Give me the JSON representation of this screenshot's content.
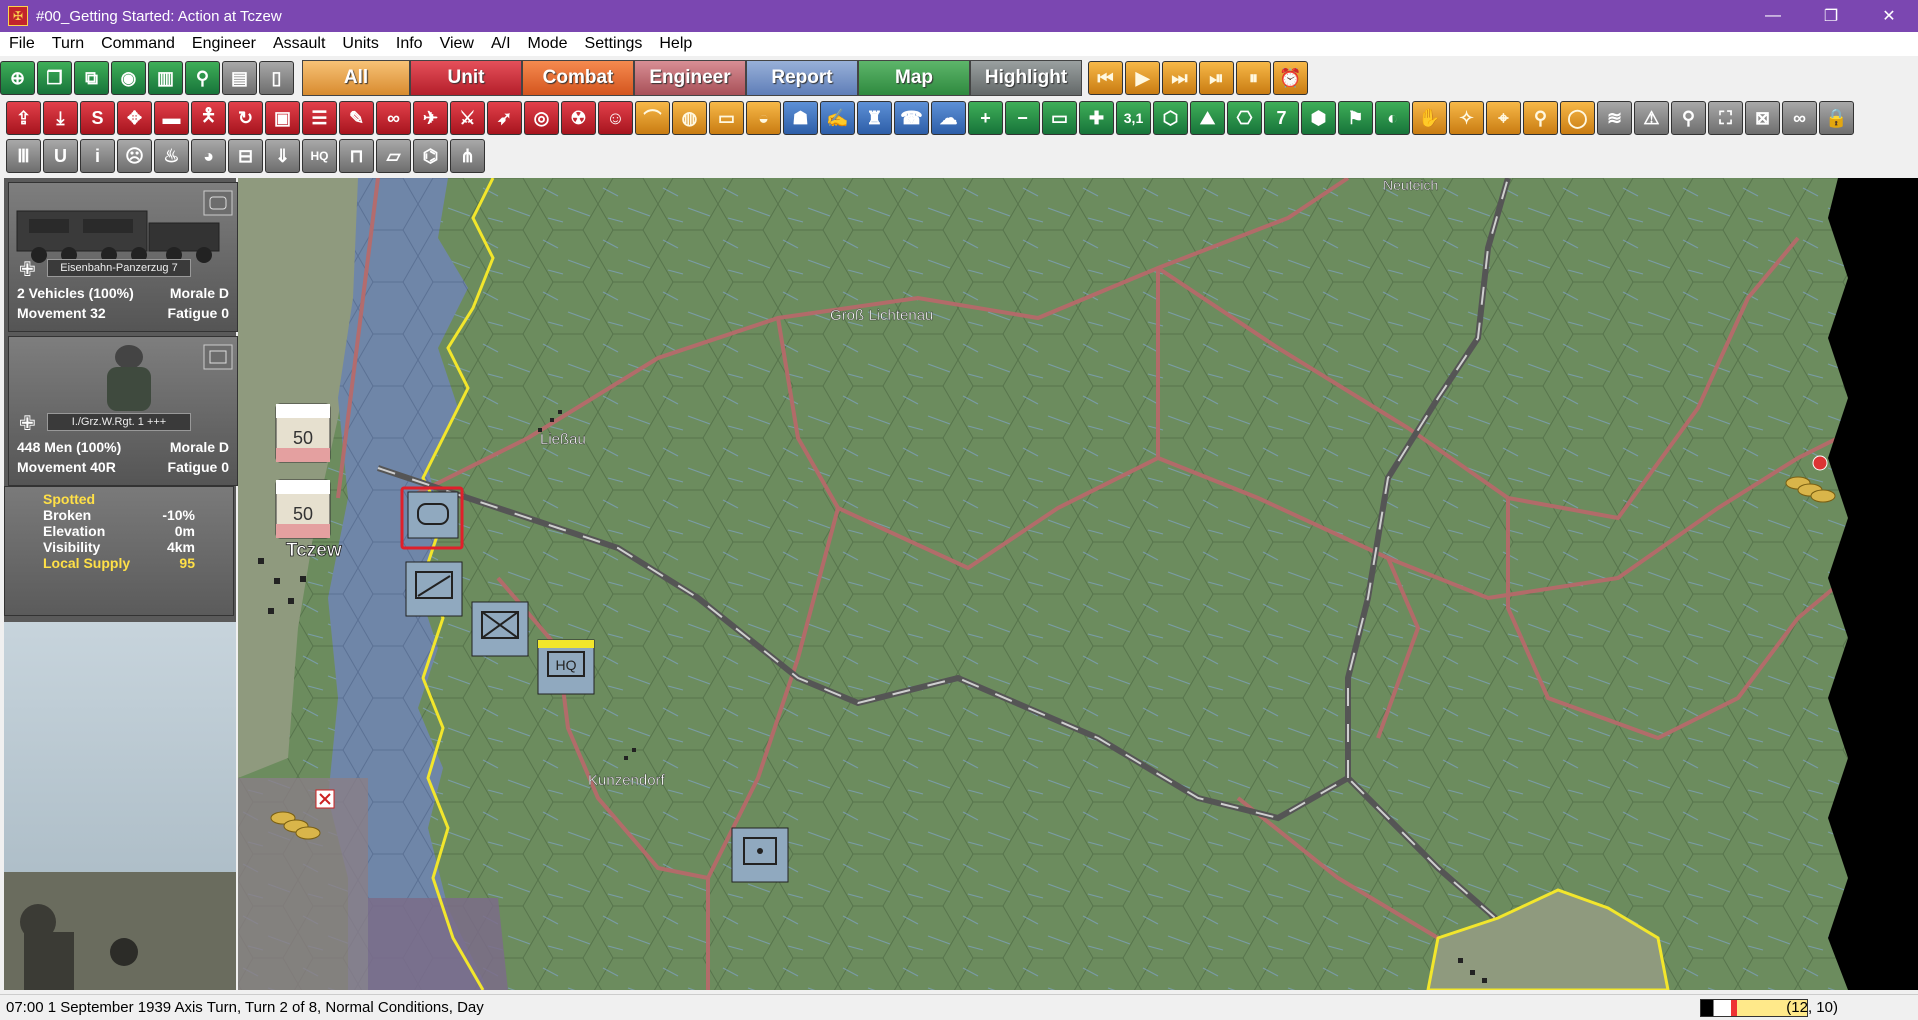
{
  "window": {
    "title": "#00_Getting Started: Action at Tczew",
    "minimize": "—",
    "restore": "❐",
    "close": "✕"
  },
  "menu": [
    "File",
    "Turn",
    "Command",
    "Engineer",
    "Assault",
    "Units",
    "Info",
    "View",
    "A/I",
    "Mode",
    "Settings",
    "Help"
  ],
  "toolbar": {
    "tabs": [
      "All",
      "Unit",
      "Combat",
      "Engineer",
      "Report",
      "Map",
      "Highlight"
    ],
    "row2_text": [
      "S",
      "3,1",
      "7"
    ],
    "row3_text": [
      "U",
      "i",
      "HQ"
    ]
  },
  "units": [
    {
      "name": "Eisenbahn-Panzerzug 7",
      "strength": "2 Vehicles (100%)",
      "morale": "Morale D",
      "movement": "Movement 32",
      "fatigue": "Fatigue 0"
    },
    {
      "name": "I./Grz.W.Rgt. 1 +++",
      "strength": "448 Men (100%)",
      "morale": "Morale D",
      "movement": "Movement 40R",
      "fatigue": "Fatigue 0"
    }
  ],
  "terrain": {
    "spotted": "Spotted",
    "rows": [
      {
        "label": "Broken",
        "value": "-10%"
      },
      {
        "label": "Elevation",
        "value": "0m"
      },
      {
        "label": "Visibility",
        "value": "4km"
      },
      {
        "label": "Local Supply",
        "value": "95"
      }
    ]
  },
  "map": {
    "places": [
      "Neuteich",
      "Groß Lichtenau",
      "Ließau",
      "Tczew",
      "Kunzendorf"
    ],
    "counters": [
      {
        "kind": "polish",
        "value": "50"
      },
      {
        "kind": "polish",
        "value": "50"
      },
      {
        "kind": "hq",
        "value": "HQ"
      }
    ]
  },
  "status": {
    "text": "07:00 1 September 1939 Axis Turn, Turn 2 of 8, Normal Conditions, Day",
    "coords": "(12, 10)"
  },
  "colors": {
    "titlebar": "#7b47b1",
    "terrain": "#6c8c5e",
    "water": "#6f86a8",
    "road": "#b66a6a",
    "railway": "#555555",
    "border": "#f2e62c"
  }
}
